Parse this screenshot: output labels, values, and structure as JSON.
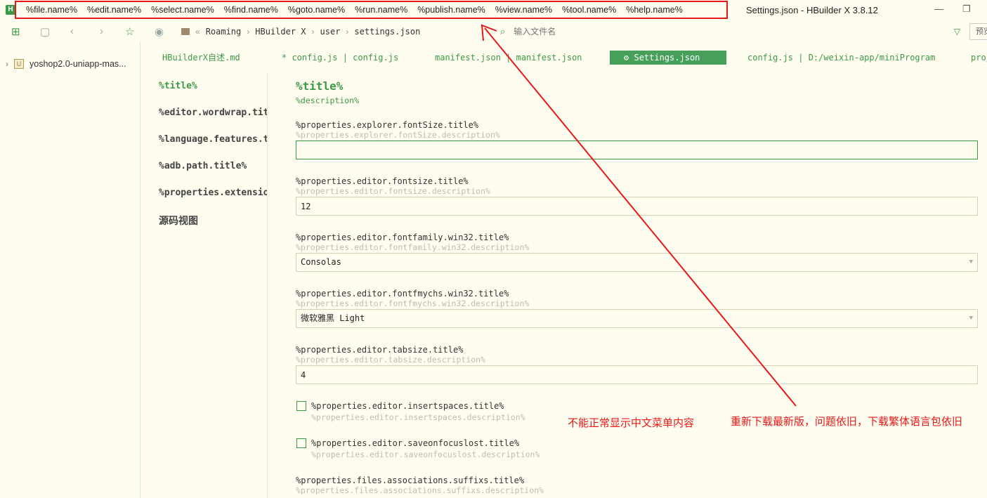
{
  "window": {
    "logo_text": "H",
    "title": "Settings.json - HBuilder X 3.8.12",
    "minimize_glyph": "—",
    "restore_glyph": "❐"
  },
  "menu": {
    "items": [
      "%file.name%",
      "%edit.name%",
      "%select.name%",
      "%find.name%",
      "%goto.name%",
      "%run.name%",
      "%publish.name%",
      "%view.name%",
      "%tool.name%",
      "%help.name%"
    ]
  },
  "toolbar": {
    "breadcrumb": [
      "Roaming",
      "HBuilder X",
      "user",
      "settings.json"
    ],
    "breadcrumb_prefix": "«",
    "search_placeholder": "输入文件名",
    "preview_label": "预览"
  },
  "sidebar": {
    "project_name": "yoshop2.0-uniapp-mas...",
    "project_icon": "U"
  },
  "tabs": [
    {
      "label": "HBuilderX自述.md"
    },
    {
      "label": "* config.js | config.js"
    },
    {
      "label": "manifest.json | manifest.json"
    },
    {
      "label": "Settings.json"
    },
    {
      "label": "config.js | D:/weixin-app/miniProgram"
    },
    {
      "label": "proj"
    }
  ],
  "settings_nav": {
    "items": [
      "%title%",
      "%editor.wordwrap.title%",
      "%language.features.title%",
      "%adb.path.title%",
      "%properties.extensions.title%",
      "源码视图"
    ]
  },
  "settings": {
    "title": "%title%",
    "description": "%description%",
    "explorer_fontsize": {
      "title": "%properties.explorer.fontSize.title%",
      "description": "%properties.explorer.fontSize.description%",
      "value": ""
    },
    "editor_fontsize": {
      "title": "%properties.editor.fontsize.title%",
      "description": "%properties.editor.fontsize.description%",
      "value": "12"
    },
    "editor_fontfamily": {
      "title": "%properties.editor.fontfamily.win32.title%",
      "description": "%properties.editor.fontfamily.win32.description%",
      "value": "Consolas"
    },
    "editor_fontfmychs": {
      "title": "%properties.editor.fontfmychs.win32.title%",
      "description": "%properties.editor.fontfmychs.win32.description%",
      "value": "微软雅黑 Light"
    },
    "editor_tabsize": {
      "title": "%properties.editor.tabsize.title%",
      "description": "%properties.editor.tabsize.description%",
      "value": "4"
    },
    "insertspaces": {
      "title": "%properties.editor.insertspaces.title%",
      "description": "%properties.editor.insertspaces.description%"
    },
    "saveonfocuslost": {
      "title": "%properties.editor.saveonfocuslost.title%",
      "description": "%properties.editor.saveonfocuslost.description%"
    },
    "files_associations": {
      "title": "%properties.files.associations.suffixs.title%",
      "description": "%properties.files.associations.suffixs.description%"
    }
  },
  "annotations": {
    "note_1": "不能正常显示中文菜单内容",
    "note_2": "重新下载最新版，问题依旧，下载繁体语言包依旧",
    "color": "#e81818"
  },
  "colors": {
    "accent": "#3b9a45",
    "background": "#fffdf0",
    "annotation": "#e81818"
  }
}
